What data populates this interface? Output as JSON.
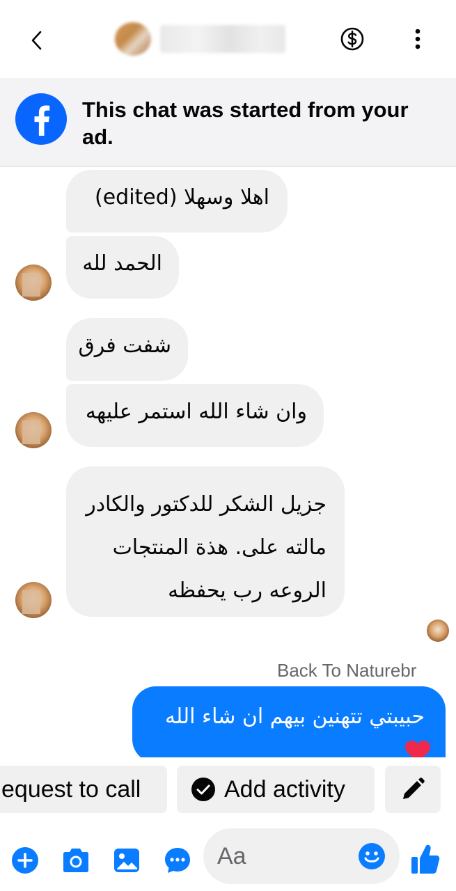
{
  "header": {
    "back_icon": "chevron-left-icon",
    "payment_icon": "dollar-icon",
    "more_icon": "more-vertical-icon"
  },
  "banner": {
    "text": "This chat was started from your ad.",
    "icon": "facebook-logo-icon"
  },
  "messages": [
    {
      "text": "اهلا وسهلا (edited)"
    },
    {
      "text": "الحمد لله"
    },
    {
      "text": "شفت فرق"
    },
    {
      "text": "وان شاء الله استمر عليهه"
    },
    {
      "lines": [
        "جزيل الشكر للدكتور والكادر",
        "مالته على. هذة المنتجات",
        "الروعه رب يحفظه"
      ]
    }
  ],
  "sent": {
    "label": "Back To Naturebr",
    "text": "حبيبتي تتهنين بيهم ان شاء الله",
    "reaction": "heart"
  },
  "actions": {
    "call": "equest to call",
    "activity": "Add activity",
    "edit_icon": "pencil-icon"
  },
  "composer": {
    "placeholder": "Aa",
    "icons": [
      "plus-icon",
      "camera-icon",
      "image-icon",
      "chat-bubble-icon",
      "emoji-icon",
      "thumbs-up-icon"
    ]
  },
  "colors": {
    "accent": "#0a7cff",
    "bubble": "#f0f0f0",
    "banner_bg": "#f3f3f5"
  }
}
